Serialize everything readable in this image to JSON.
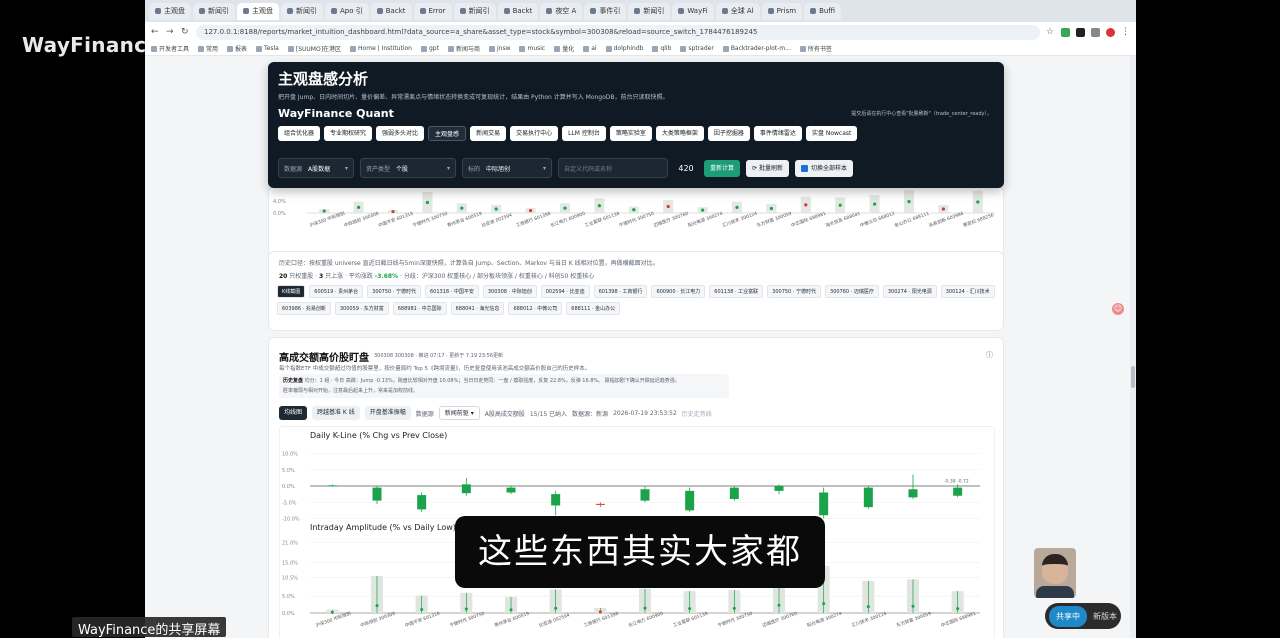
{
  "overlay": {
    "watermark": "WayFinance",
    "share_label": "WayFinance的共享屏幕",
    "subtitle": "这些东西其实大家都",
    "control_primary": "共享中",
    "control_secondary": "新版本"
  },
  "browser": {
    "tabs": [
      "主观盘",
      "新闻引",
      "主观盘",
      "新闻引",
      "Apo 引",
      "Backt",
      "Error",
      "新闻引",
      "Backt",
      "夜空 A",
      "事件引",
      "新闻引",
      "WayFi",
      "全球 Al",
      "Prism",
      "Buffi"
    ],
    "active_tab_index": 2,
    "url": "127.0.0.1:8188/reports/market_intuition_dashboard.html?data_source=a_share&asset_type=stock&symbol=300308&reload=source_switch_1784476189245",
    "bookmarks": [
      "开发者工具",
      "常用",
      "报表",
      "Tesla",
      "[SUUMO]在港区",
      "Home | Institution",
      "gpt",
      "新闻与商",
      "jnsw",
      "music",
      "量化",
      "ai",
      "dolphindb",
      "qlib",
      "sptrader",
      "Backtrader-plot-m...",
      "所有书签"
    ]
  },
  "header": {
    "title": "主观盘感分析",
    "description": "把开盘 Jump、日内时间切片、量价偏差、异常漂离点与情绪状态转换变成可复现统计，结果由 Python 计算并写入 MongoDB，前台只读取快照。",
    "brand": "WayFinance Quant",
    "hint": "提交后请在执行中心查看\"批量刷新\"（trade_center_ready）。",
    "nav": [
      "组合优化器",
      "专业期权研究",
      "强弱多头对比",
      "主观盘感",
      "新闻交易",
      "交易执行中心",
      "LLM 控制台",
      "策略实验室",
      "大类策略框架",
      "因子挖掘器",
      "事件情绪雷达",
      "实盘 Nowcast"
    ],
    "active_nav_index": 3,
    "controls": {
      "source_label": "数据源",
      "source_value": "A股数据",
      "asset_label": "资产类型",
      "asset_value": "个股",
      "symbol_label": "标的",
      "symbol_value": "中际旭创",
      "search_placeholder": "自定义代码或名称",
      "count": "420",
      "recompute": "重新计算",
      "batch_refresh": "批量刷新",
      "cross_universe": "切换全部样本"
    }
  },
  "top_section": {
    "y_ticks": [
      "4.0%",
      "0.0%"
    ],
    "x_labels": [
      "沪深300 中际旭创",
      "中际旭创 300308",
      "中国平安 601318",
      "宁德时代 300750",
      "贵州茅台 600519",
      "比亚迪 002594",
      "工商银行 601398",
      "长江电力 600900",
      "工业富联 601138",
      "宁德时代 300750",
      "迈瑞医疗 300760",
      "阳光电源 300274",
      "汇川技术 300124",
      "东方财富 300059",
      "中芯国际 688981",
      "海光信息 688041",
      "中微公司 688012",
      "金山办公 688111",
      "兆易创新 603986",
      "寒武纪 688256"
    ],
    "history_note": "历史口径：按权重股 universe 直近日截日线与5min深度快照，计算各自 Jump、Section、Markov 与当日 K 线相对位置，再做横截面对比。",
    "stats": "20 只权重股 · 3 只上涨 · 平均涨跌 -3.68% · 分歧：沪深300 权重核心 / 部分板块领涨 / 权重核心 / 科创50 权重核心",
    "stats_count": "20",
    "stats_up": "3",
    "stats_avg": "-3.68%",
    "chips": [
      "K线截图",
      "600519 · 贵州茅台",
      "300750 · 宁德时代",
      "601318 · 中国平安",
      "300308 · 中际旭创",
      "002594 · 比亚迪",
      "601398 · 工商银行",
      "600900 · 长江电力",
      "601138 · 工业富联",
      "300750 · 宁德时代",
      "300760 · 迈瑞医疗",
      "300274 · 阳光电源",
      "300124 · 汇川技术",
      "603986 · 兆易创新",
      "300059 · 东方财富",
      "688981 · 中芯国际",
      "688041 · 海光信息",
      "688012 · 中微公司",
      "688111 · 金山办公"
    ]
  },
  "ledger": {
    "title": "高成交额高价股盯盘",
    "meta": "300308 300308 · 推进 07:17 · 更新于 7.19 23:56更新",
    "description": "每个指数ETF 中成交额超过均值的股票里，按价量局约 Top 5《跨境流量》，历史复盘使用该池高成交额高价股自己的历史样本。",
    "history_caption": "历史复盘",
    "history_line1": "均分：1 组 · 今日 高跳：Jump -0.13%，跨盘比较相对开盘 10.08%；当日日走势同：一盘 / 摸取强度，反复 22.8%，反弹 16.8%。 跌幅加剧下确认开跌延迟趋势强。",
    "history_line2": "胜率偏弱与相对开始，注意最后起来上升，常来是加权前线。",
    "toolbar": [
      "均线图",
      "跨越基准 K 线",
      "开盘基准振幅"
    ],
    "source_label": "数据源",
    "source_value": "新闻前驱",
    "status_main": "A股高成交额股",
    "status_count": "15/15 已纳入",
    "status_source": "数据源：新源",
    "status_time": "2026-07-19 23:53:52",
    "status_hint": "历史走势线",
    "info_icon": "ⓘ"
  },
  "chart_data": [
    {
      "type": "candlestick",
      "title": "Daily K-Line (% Chg vs Prev Close)",
      "ylabel": "",
      "y_ticks": [
        "10.0%",
        "5.0%",
        "0.0%",
        "-5.0%",
        "-10.0%"
      ],
      "ylim": [
        -12,
        12
      ],
      "annotation": "-0.38  -0.72",
      "candles": [
        {
          "open": 0.2,
          "close": 0.1,
          "high": 0.5,
          "low": -0.2,
          "up": false
        },
        {
          "open": -0.5,
          "close": -4.5,
          "high": 0.0,
          "low": -5.5,
          "up": false
        },
        {
          "open": -2.8,
          "close": -7.2,
          "high": -2.0,
          "low": -8.0,
          "up": false
        },
        {
          "open": 0.5,
          "close": -2.2,
          "high": 2.5,
          "low": -3.0,
          "up": false
        },
        {
          "open": -0.5,
          "close": -2.0,
          "high": 0.2,
          "low": -2.5,
          "up": false
        },
        {
          "open": -2.5,
          "close": -6.0,
          "high": -1.5,
          "low": -9.0,
          "up": false
        },
        {
          "open": -5.8,
          "close": -5.5,
          "high": -5.0,
          "low": -6.5,
          "up": true
        },
        {
          "open": -1.0,
          "close": -4.5,
          "high": 0.0,
          "low": -5.0,
          "up": false
        },
        {
          "open": -1.5,
          "close": -7.5,
          "high": -0.5,
          "low": -8.0,
          "up": false
        },
        {
          "open": -0.5,
          "close": -4.0,
          "high": 0.0,
          "low": -4.5,
          "up": false
        },
        {
          "open": 0.0,
          "close": -1.5,
          "high": 0.5,
          "low": -2.5,
          "up": false
        },
        {
          "open": -2.0,
          "close": -9.0,
          "high": -0.5,
          "low": -10.0,
          "up": false
        },
        {
          "open": -0.5,
          "close": -6.5,
          "high": 0.0,
          "low": -7.0,
          "up": false
        },
        {
          "open": -1.0,
          "close": -3.5,
          "high": 3.5,
          "low": -4.0,
          "up": false
        },
        {
          "open": -0.5,
          "close": -3.0,
          "high": 0.5,
          "low": -3.5,
          "up": false
        }
      ]
    },
    {
      "type": "bar",
      "title": "Intraday Amplitude (% vs Daily Low)",
      "y_ticks": [
        "21.0%",
        "15.0%",
        "10.5%",
        "5.0%",
        "0.0%"
      ],
      "ylim": [
        0,
        22
      ],
      "values": [
        1.0,
        11.0,
        5.2,
        6.0,
        4.8,
        7.0,
        1.5,
        7.2,
        6.5,
        6.8,
        11.5,
        14.0,
        9.5,
        10.0,
        6.5
      ]
    },
    {
      "type": "bar",
      "title": "",
      "y_ticks": [
        "4.0%",
        "0.0%"
      ],
      "ylim": [
        0,
        8
      ],
      "values": [
        1.2,
        3.5,
        0.9,
        6.5,
        3.0,
        2.5,
        1.5,
        3.0,
        4.5,
        2.0,
        4.0,
        1.8,
        3.5,
        2.8,
        5.0,
        4.8,
        5.5,
        7.0,
        2.5,
        6.8
      ]
    }
  ],
  "colors": {
    "header_bg": "#0f1a24",
    "up": "#d9363e",
    "down": "#1aa34a",
    "accent": "#1b9e77",
    "bar_fill": "#dfe6df"
  }
}
